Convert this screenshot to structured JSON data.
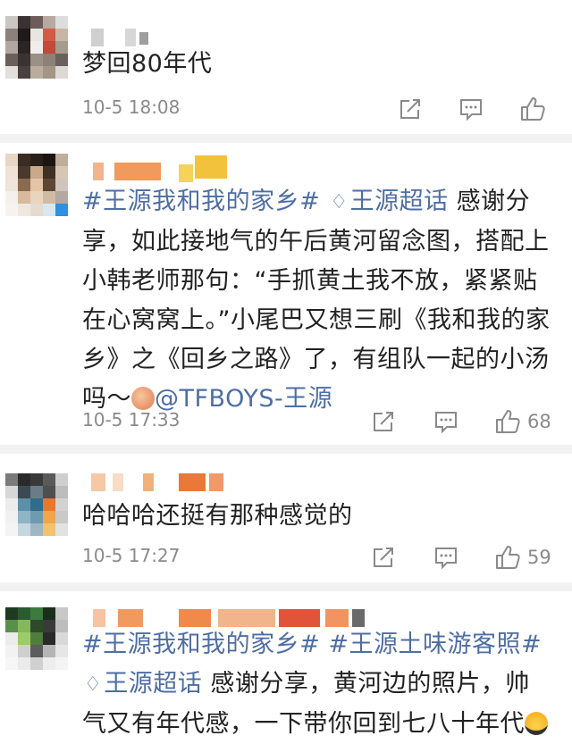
{
  "comments": [
    {
      "text": "梦回80年代",
      "time": "10-5 18:08",
      "likes": ""
    },
    {
      "tag1": "#王源我和我的家乡#",
      "tag2": "王源超话",
      "text1": "感谢分享，如此接地气的午后黄河留念图，搭配上小韩老师那句：“手抓黄土我不放，紧紧贴在心窝窝上。”小尾巴又想三刷《我和我的家乡》之《回乡之路》了，有组队一起的小汤吗～",
      "mention": "@TFBOYS-王源",
      "time": "10-5 17:33",
      "likes": "68"
    },
    {
      "text": "哈哈哈还挺有那种感觉的",
      "time": "10-5 17:27",
      "likes": "59"
    },
    {
      "tag1": "#王源我和我的家乡#",
      "tag2": "#王源土味游客照#",
      "tag3": "王源超话",
      "text1": "感谢分享，黄河边的照片，帅气又有年代感，一下带你回到七八十年代"
    }
  ],
  "icons": {
    "share": "share-icon",
    "comment": "comment-icon",
    "like": "like-icon",
    "supertopic": "diamond-icon"
  },
  "colors": {
    "link": "#4e6ea4",
    "meta": "#8a8a8a"
  }
}
